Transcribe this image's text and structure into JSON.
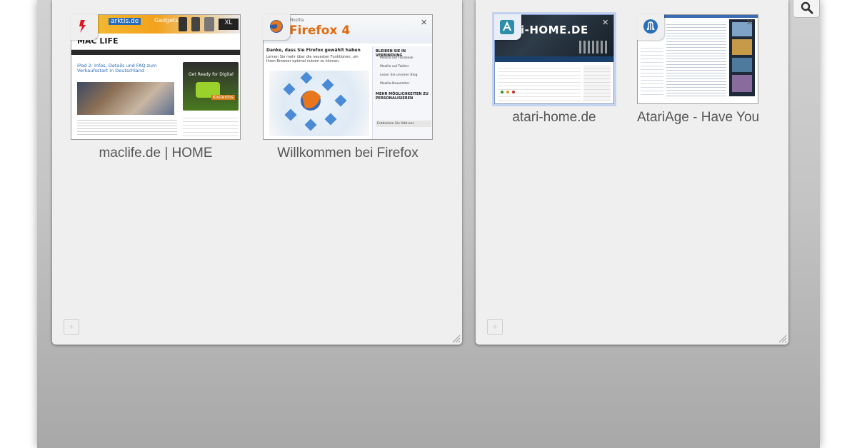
{
  "groups": [
    {
      "tabs": [
        {
          "title": "maclife.de | HOME",
          "favicon": "maclife-favicon",
          "close_glyph": ""
        },
        {
          "title": "Willkommen bei Firefox",
          "favicon": "firefox-favicon",
          "close_glyph": "×"
        }
      ]
    },
    {
      "tabs": [
        {
          "title": "atari-home.de",
          "favicon": "atari-home-favicon",
          "close_glyph": "×",
          "active": true
        },
        {
          "title": "AtariAge - Have You Played Atari Today?",
          "favicon": "atariage-favicon",
          "close_glyph": "×"
        }
      ]
    }
  ],
  "thumbnails": {
    "maclife": {
      "banner": "arktis.de",
      "banner_tag": "Gadgets",
      "brand": "MAC LIFE",
      "headline": "iPad 2: Infos, Details und FAQ zum Verkaufsstart in Deutschland",
      "ad_line1": "Get Ready for Digital",
      "ad_button": "Kostenlos"
    },
    "firefox": {
      "brand_small": "Mozilla",
      "brand": "Firefox 4",
      "heading": "Danke, dass Sie Firefox gewählt haben",
      "sub": "Lernen Sie mehr über die neuesten Funktionen, um Ihren Browser optimal nutzen zu können.",
      "side_heading": "BLEIBEN SIE IN VERBINDUNG",
      "side_items": [
        "Mozilla auf Facebook",
        "Mozilla auf Twitter",
        "Lesen Sie unseren Blog",
        "Mozilla-Newsletter"
      ],
      "side_heading2": "MEHR MÖGLICHKEITEN ZU PERSONALISIEREN",
      "side_button": "Entdecken Sie Add-ons"
    },
    "atari_home": {
      "brand": "i-HOME.DE"
    }
  },
  "colors": {
    "accent_active": "#c6d3ef",
    "workspace_top": "#d2d2d2",
    "workspace_bottom": "#a8a8a8"
  },
  "toolbar": {
    "search_icon": "magnifier"
  }
}
